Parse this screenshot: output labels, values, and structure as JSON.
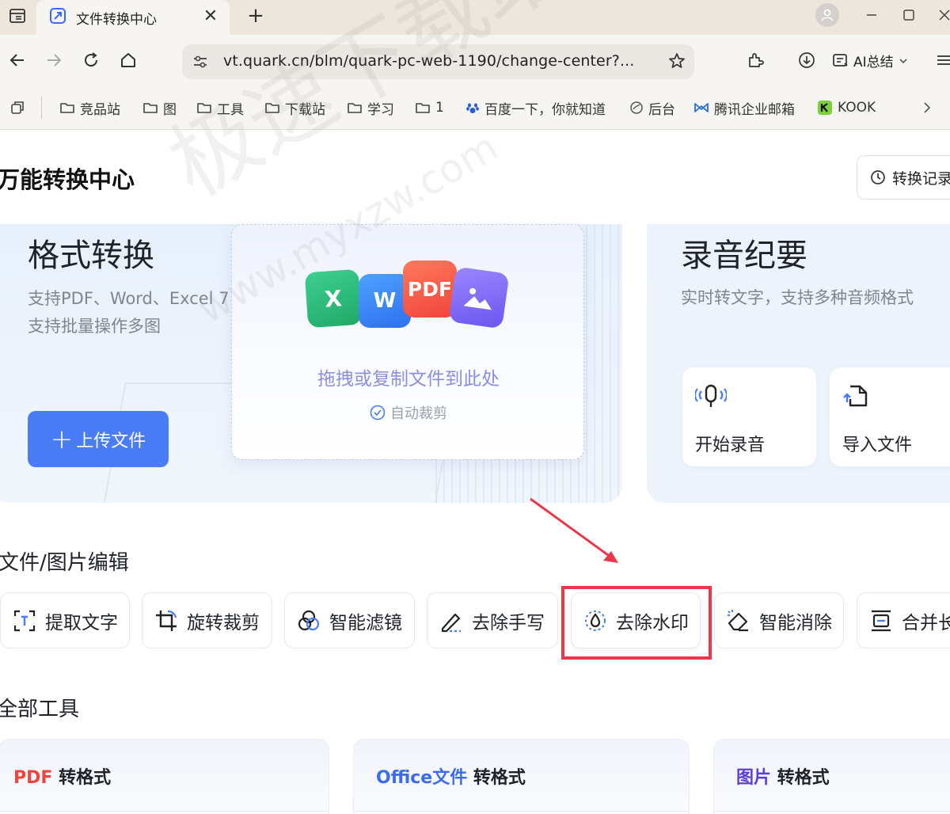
{
  "browser": {
    "tab_title": "文件转换中心",
    "tab_close": "✕",
    "new_tab": "+",
    "url": "vt.quark.cn/blm/quark-pc-web-1190/change-center?...",
    "ai_summary": "AI总结"
  },
  "bookmarks": [
    {
      "label": "竞品站",
      "icon": "folder-icon"
    },
    {
      "label": "图",
      "icon": "folder-icon"
    },
    {
      "label": "工具",
      "icon": "folder-icon"
    },
    {
      "label": "下载站",
      "icon": "folder-icon"
    },
    {
      "label": "学习",
      "icon": "folder-icon"
    },
    {
      "label": "1",
      "icon": "folder-icon"
    },
    {
      "label": "百度一下，你就知道",
      "icon": "baidu-icon"
    },
    {
      "label": "后台",
      "icon": "globe-icon"
    },
    {
      "label": "腾讯企业邮箱",
      "icon": "tencent-mail-icon"
    },
    {
      "label": "KOOK",
      "icon": "kook-icon"
    }
  ],
  "page": {
    "title": "万能转换中心",
    "history_button": "转换记录"
  },
  "format_card": {
    "title": "格式转换",
    "desc_line1": "支持PDF、Word、Excel 7",
    "desc_line2": "支持批量操作多图",
    "upload_label": "上传文件",
    "upload_plus": "+",
    "drop_text": "拖拽或复制文件到此处",
    "auto_crop": "自动裁剪",
    "file_icons": {
      "excel": "X",
      "word": "W",
      "pdf": "PDF"
    }
  },
  "record_card": {
    "title": "录音纪要",
    "desc": "实时转文字，支持多种音频格式",
    "tiles": [
      {
        "label": "开始录音",
        "icon": "microphone-icon"
      },
      {
        "label": "导入文件",
        "icon": "import-file-icon"
      }
    ]
  },
  "edit_section": {
    "title": "文件/图片编辑",
    "tools": [
      {
        "label": "提取文字",
        "icon": "text-extract-icon"
      },
      {
        "label": "旋转裁剪",
        "icon": "crop-icon"
      },
      {
        "label": "智能滤镜",
        "icon": "filter-icon"
      },
      {
        "label": "去除手写",
        "icon": "erase-handwriting-icon"
      },
      {
        "label": "去除水印",
        "icon": "watermark-remove-icon"
      },
      {
        "label": "智能消除",
        "icon": "eraser-icon"
      },
      {
        "label": "合并长",
        "icon": "merge-icon"
      }
    ]
  },
  "all_tools": {
    "title": "全部工具",
    "cards": [
      {
        "accent": "PDF",
        "rest": " 转格式",
        "accent_color": "#f0443c"
      },
      {
        "accent": "Office文件",
        "rest": " 转格式",
        "accent_color": "#3b6cf0"
      },
      {
        "accent": "图片",
        "rest": " 转格式",
        "accent_color": "#5a3fd8"
      }
    ]
  },
  "watermark_text": {
    "main": "极速下载站",
    "url": "www.myxzw.com"
  },
  "colors": {
    "primary": "#4a7cf7",
    "highlight": "#e8384a",
    "arrow": "#e8384a"
  }
}
